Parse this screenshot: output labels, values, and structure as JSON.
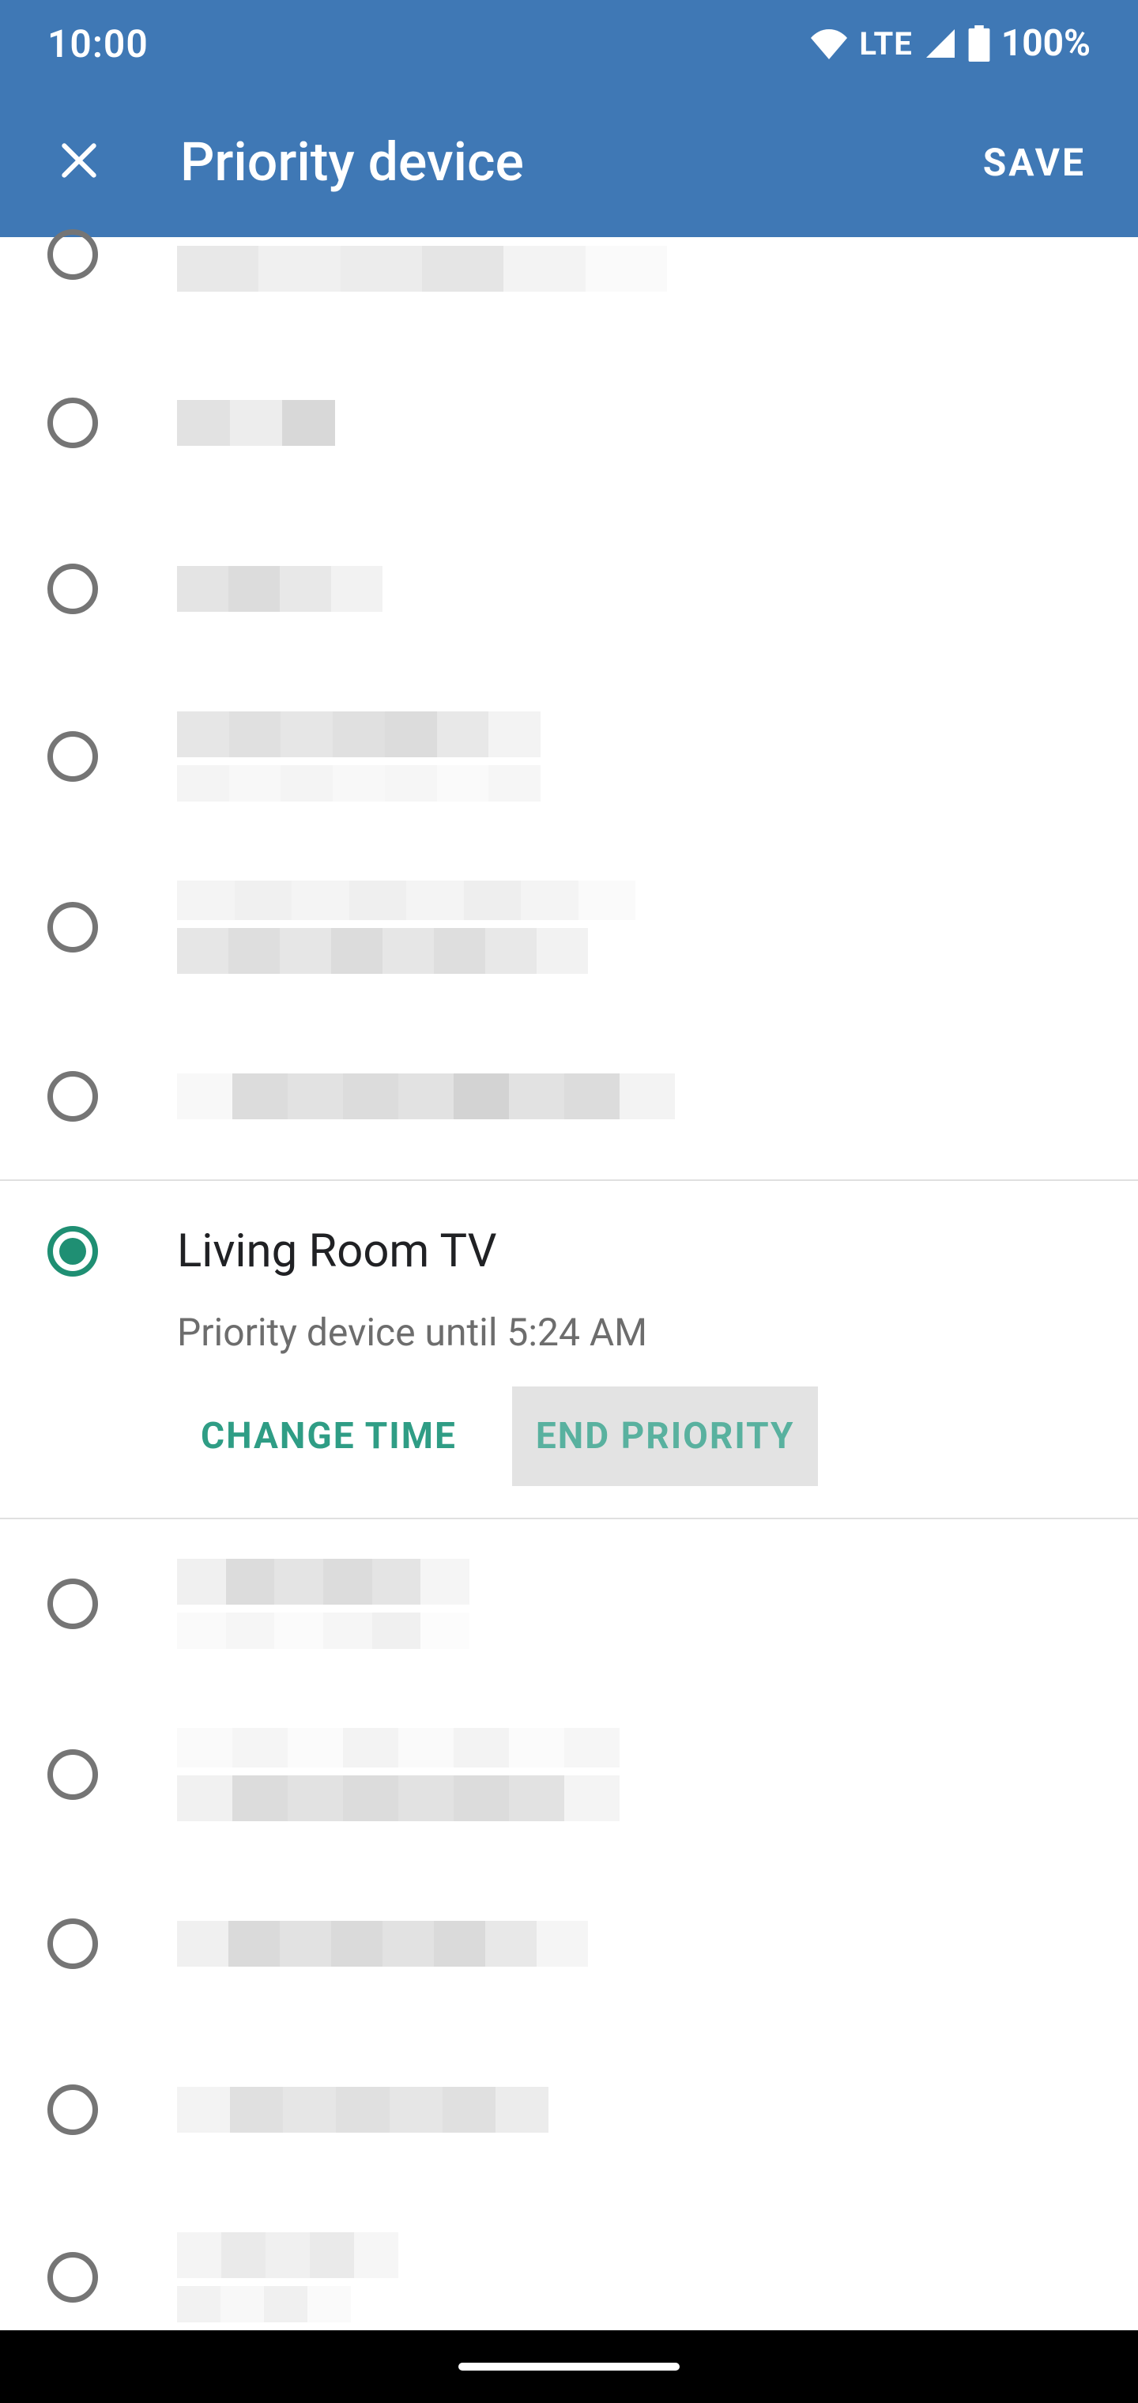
{
  "status": {
    "time": "10:00",
    "network_label": "LTE",
    "battery_pct": "100%"
  },
  "appbar": {
    "title": "Priority device",
    "save": "SAVE"
  },
  "selected": {
    "name": "Living Room TV",
    "subtitle": "Priority device until 5:24 AM",
    "change_time": "CHANGE TIME",
    "end_priority": "END PRIORITY"
  },
  "colors": {
    "primary": "#3f78b5",
    "accent": "#2f9d85"
  }
}
